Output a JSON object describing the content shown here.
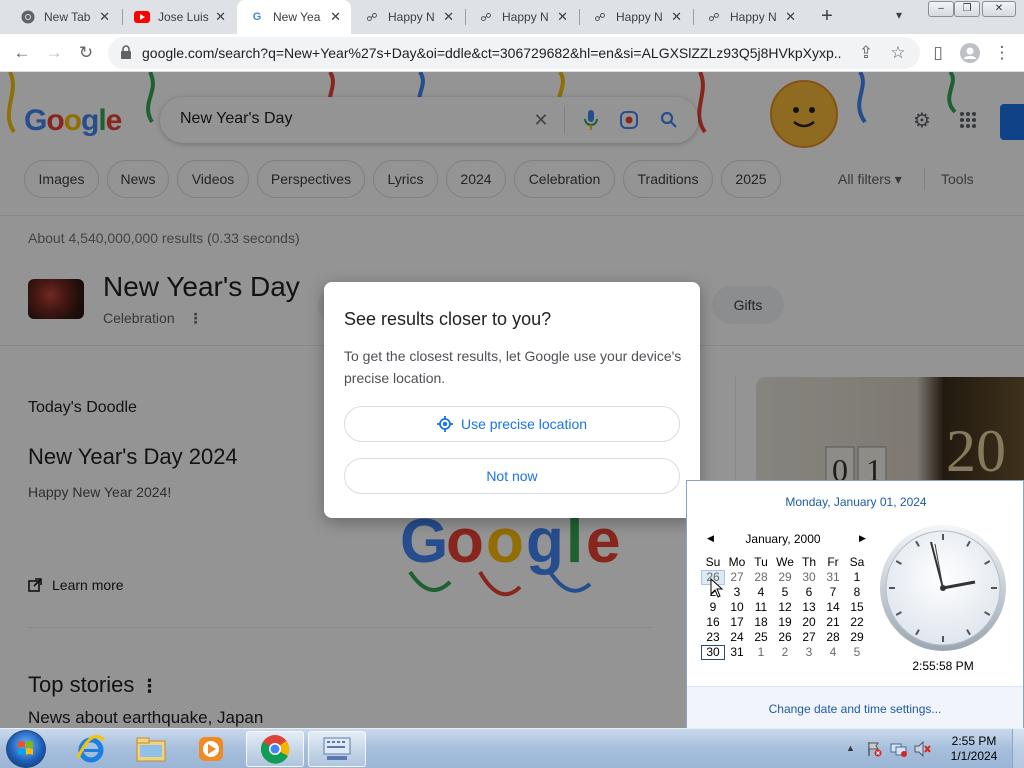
{
  "browser": {
    "tabs": [
      {
        "title": "New Tab",
        "icon": "chrome-icon"
      },
      {
        "title": "Jose Luis",
        "icon": "youtube-icon"
      },
      {
        "title": "New Year",
        "icon": "google-icon",
        "active": true
      },
      {
        "title": "Happy N",
        "icon": "site-icon"
      },
      {
        "title": "Happy N",
        "icon": "site-icon"
      },
      {
        "title": "Happy N",
        "icon": "site-icon"
      },
      {
        "title": "Happy N",
        "icon": "site-icon"
      }
    ],
    "new_tab": "+",
    "url": "google.com/search?q=New+Year%27s+Day&oi=ddle&ct=306729682&hl=en&si=ALGXSlZZLz93Q5j8HVkpXyxp..."
  },
  "search": {
    "logo": "Google",
    "query": "New Year's Day",
    "chips": [
      "Images",
      "News",
      "Videos",
      "Perspectives",
      "Lyrics",
      "2024",
      "Celebration",
      "Traditions",
      "2025"
    ],
    "all_filters": "All filters",
    "tools": "Tools",
    "stats": "About 4,540,000,000 results (0.33 seconds)"
  },
  "knowledge_panel": {
    "title": "New Year's Day",
    "subtitle": "Celebration",
    "chip": "Gifts"
  },
  "doodle": {
    "section": "Today's Doodle",
    "title": "New Year's Day 2024",
    "description": "Happy New Year 2024!",
    "learn_more": "Learn more"
  },
  "top_stories": {
    "title": "Top stories",
    "sub": "News about earthquake, Japan"
  },
  "dialog": {
    "title": "See results closer to you?",
    "body": "To get the closest results, let Google use your device's precise location.",
    "primary": "Use precise location",
    "secondary": "Not now"
  },
  "calendar_flyout": {
    "long_date": "Monday, January 01, 2024",
    "month_label": "January, 2000",
    "weekdays": [
      "Su",
      "Mo",
      "Tu",
      "We",
      "Th",
      "Fr",
      "Sa"
    ],
    "weeks": [
      [
        "26",
        "27",
        "28",
        "29",
        "30",
        "31",
        "1"
      ],
      [
        "2",
        "3",
        "4",
        "5",
        "6",
        "7",
        "8"
      ],
      [
        "9",
        "10",
        "11",
        "12",
        "13",
        "14",
        "15"
      ],
      [
        "16",
        "17",
        "18",
        "19",
        "20",
        "21",
        "22"
      ],
      [
        "23",
        "24",
        "25",
        "26",
        "27",
        "28",
        "29"
      ],
      [
        "30",
        "31",
        "1",
        "2",
        "3",
        "4",
        "5"
      ]
    ],
    "clock_time": "2:55:58 PM",
    "settings_link": "Change date and time settings..."
  },
  "taskbar": {
    "time": "2:55 PM",
    "date": "1/1/2024"
  },
  "colors": {
    "google_blue": "#4285F4",
    "google_red": "#EA4335",
    "google_yellow": "#FBBC05",
    "google_green": "#34A853",
    "link_blue": "#1a73e8",
    "win_link": "#1e5aa8"
  }
}
